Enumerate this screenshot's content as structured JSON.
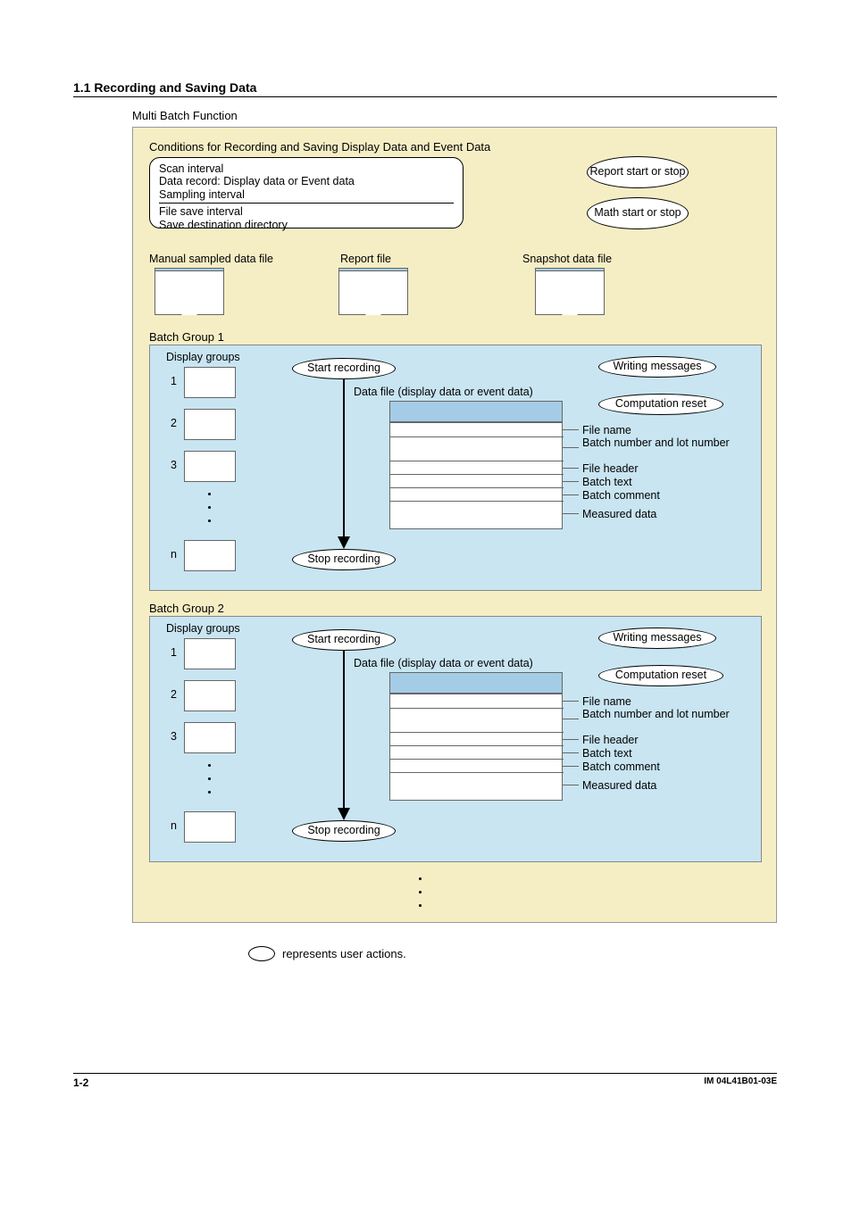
{
  "header": "1.1  Recording and Saving Data",
  "multiBatch": "Multi Batch Function",
  "conditionsTitle": "Conditions for Recording and Saving Display Data and Event Data",
  "cond": {
    "l1": "Scan interval",
    "l2": "Data record: Display data or Event data",
    "l3": "Sampling interval",
    "l4": "File save interval",
    "l5": "Save destination directory"
  },
  "topEllipses": {
    "report": "Report start or stop",
    "math": "Math start or stop"
  },
  "files": {
    "manual": "Manual sampled data file",
    "report": "Report file",
    "snapshot": "Snapshot data file"
  },
  "batchGroups": [
    {
      "title": "Batch Group 1"
    },
    {
      "title": "Batch Group 2"
    }
  ],
  "bg": {
    "displayGroups": "Display groups",
    "n1": "1",
    "n2": "2",
    "n3": "3",
    "nN": "n",
    "start": "Start recording",
    "stop": "Stop recording",
    "writing": "Writing messages",
    "comp": "Computation reset",
    "dataFile": "Data file (display data or event data)",
    "fileItems": {
      "a": "File name",
      "b": "Batch number and lot number",
      "c": "File header",
      "d": "Batch text",
      "e": "Batch comment",
      "f": "Measured data"
    }
  },
  "legend": "represents user actions.",
  "footer": {
    "page": "1-2",
    "doc": "IM 04L41B01-03E"
  }
}
